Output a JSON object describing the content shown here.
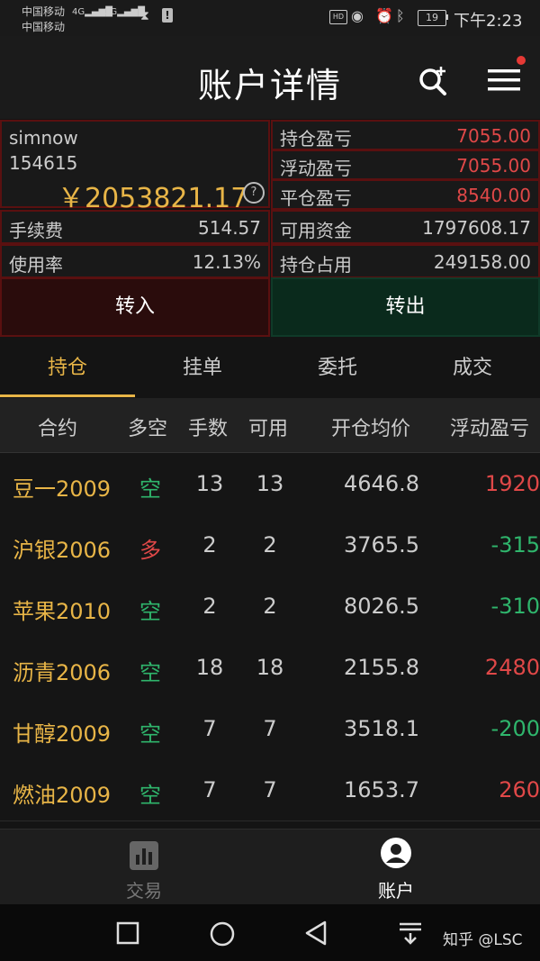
{
  "status_bar": {
    "carrier1": "中国移动",
    "carrier2": "中国移动",
    "signal1": "4G",
    "signal2": "2G",
    "hd": "HD",
    "battery": "19",
    "time": "下午2:23"
  },
  "header": {
    "title": "账户详情"
  },
  "account": {
    "name": "simnow",
    "id": "154615",
    "balance": "￥2053821.17",
    "help": "?"
  },
  "pnl": {
    "position_label": "持仓盈亏",
    "position_value": "7055.00",
    "floating_label": "浮动盈亏",
    "floating_value": "7055.00",
    "closed_label": "平仓盈亏",
    "closed_value": "8540.00"
  },
  "stats": {
    "fee_label": "手续费",
    "fee_value": "514.57",
    "available_label": "可用资金",
    "available_value": "1797608.17",
    "usage_label": "使用率",
    "usage_value": "12.13%",
    "margin_label": "持仓占用",
    "margin_value": "249158.00"
  },
  "actions": {
    "transfer_in": "转入",
    "transfer_out": "转出"
  },
  "tabs": [
    {
      "label": "持仓",
      "active": true
    },
    {
      "label": "挂单",
      "active": false
    },
    {
      "label": "委托",
      "active": false
    },
    {
      "label": "成交",
      "active": false
    }
  ],
  "table": {
    "headers": [
      "合约",
      "多空",
      "手数",
      "可用",
      "开仓均价",
      "浮动盈亏"
    ],
    "rows": [
      {
        "contract": "豆一2009",
        "direction": "空",
        "lots": "13",
        "available": "13",
        "avg_price": "4646.8",
        "pnl": "1920",
        "dir_color": "#2fb56c",
        "pnl_color": "#e04848"
      },
      {
        "contract": "沪银2006",
        "direction": "多",
        "lots": "2",
        "available": "2",
        "avg_price": "3765.5",
        "pnl": "-315",
        "dir_color": "#e04848",
        "pnl_color": "#2fb56c"
      },
      {
        "contract": "苹果2010",
        "direction": "空",
        "lots": "2",
        "available": "2",
        "avg_price": "8026.5",
        "pnl": "-310",
        "dir_color": "#2fb56c",
        "pnl_color": "#2fb56c"
      },
      {
        "contract": "沥青2006",
        "direction": "空",
        "lots": "18",
        "available": "18",
        "avg_price": "2155.8",
        "pnl": "2480",
        "dir_color": "#2fb56c",
        "pnl_color": "#e04848"
      },
      {
        "contract": "甘醇2009",
        "direction": "空",
        "lots": "7",
        "available": "7",
        "avg_price": "3518.1",
        "pnl": "-200",
        "dir_color": "#2fb56c",
        "pnl_color": "#2fb56c"
      },
      {
        "contract": "燃油2009",
        "direction": "空",
        "lots": "7",
        "available": "7",
        "avg_price": "1653.7",
        "pnl": "260",
        "dir_color": "#2fb56c",
        "pnl_color": "#e04848"
      }
    ]
  },
  "bottom_nav": {
    "trade_label": "交易",
    "trade_icon": "bar-chart-icon",
    "account_label": "账户",
    "account_icon": "user-icon"
  },
  "watermark": "知乎 @LSC",
  "colors": {
    "accent": "#e8b547",
    "up": "#e04848",
    "down": "#2fb56c"
  }
}
